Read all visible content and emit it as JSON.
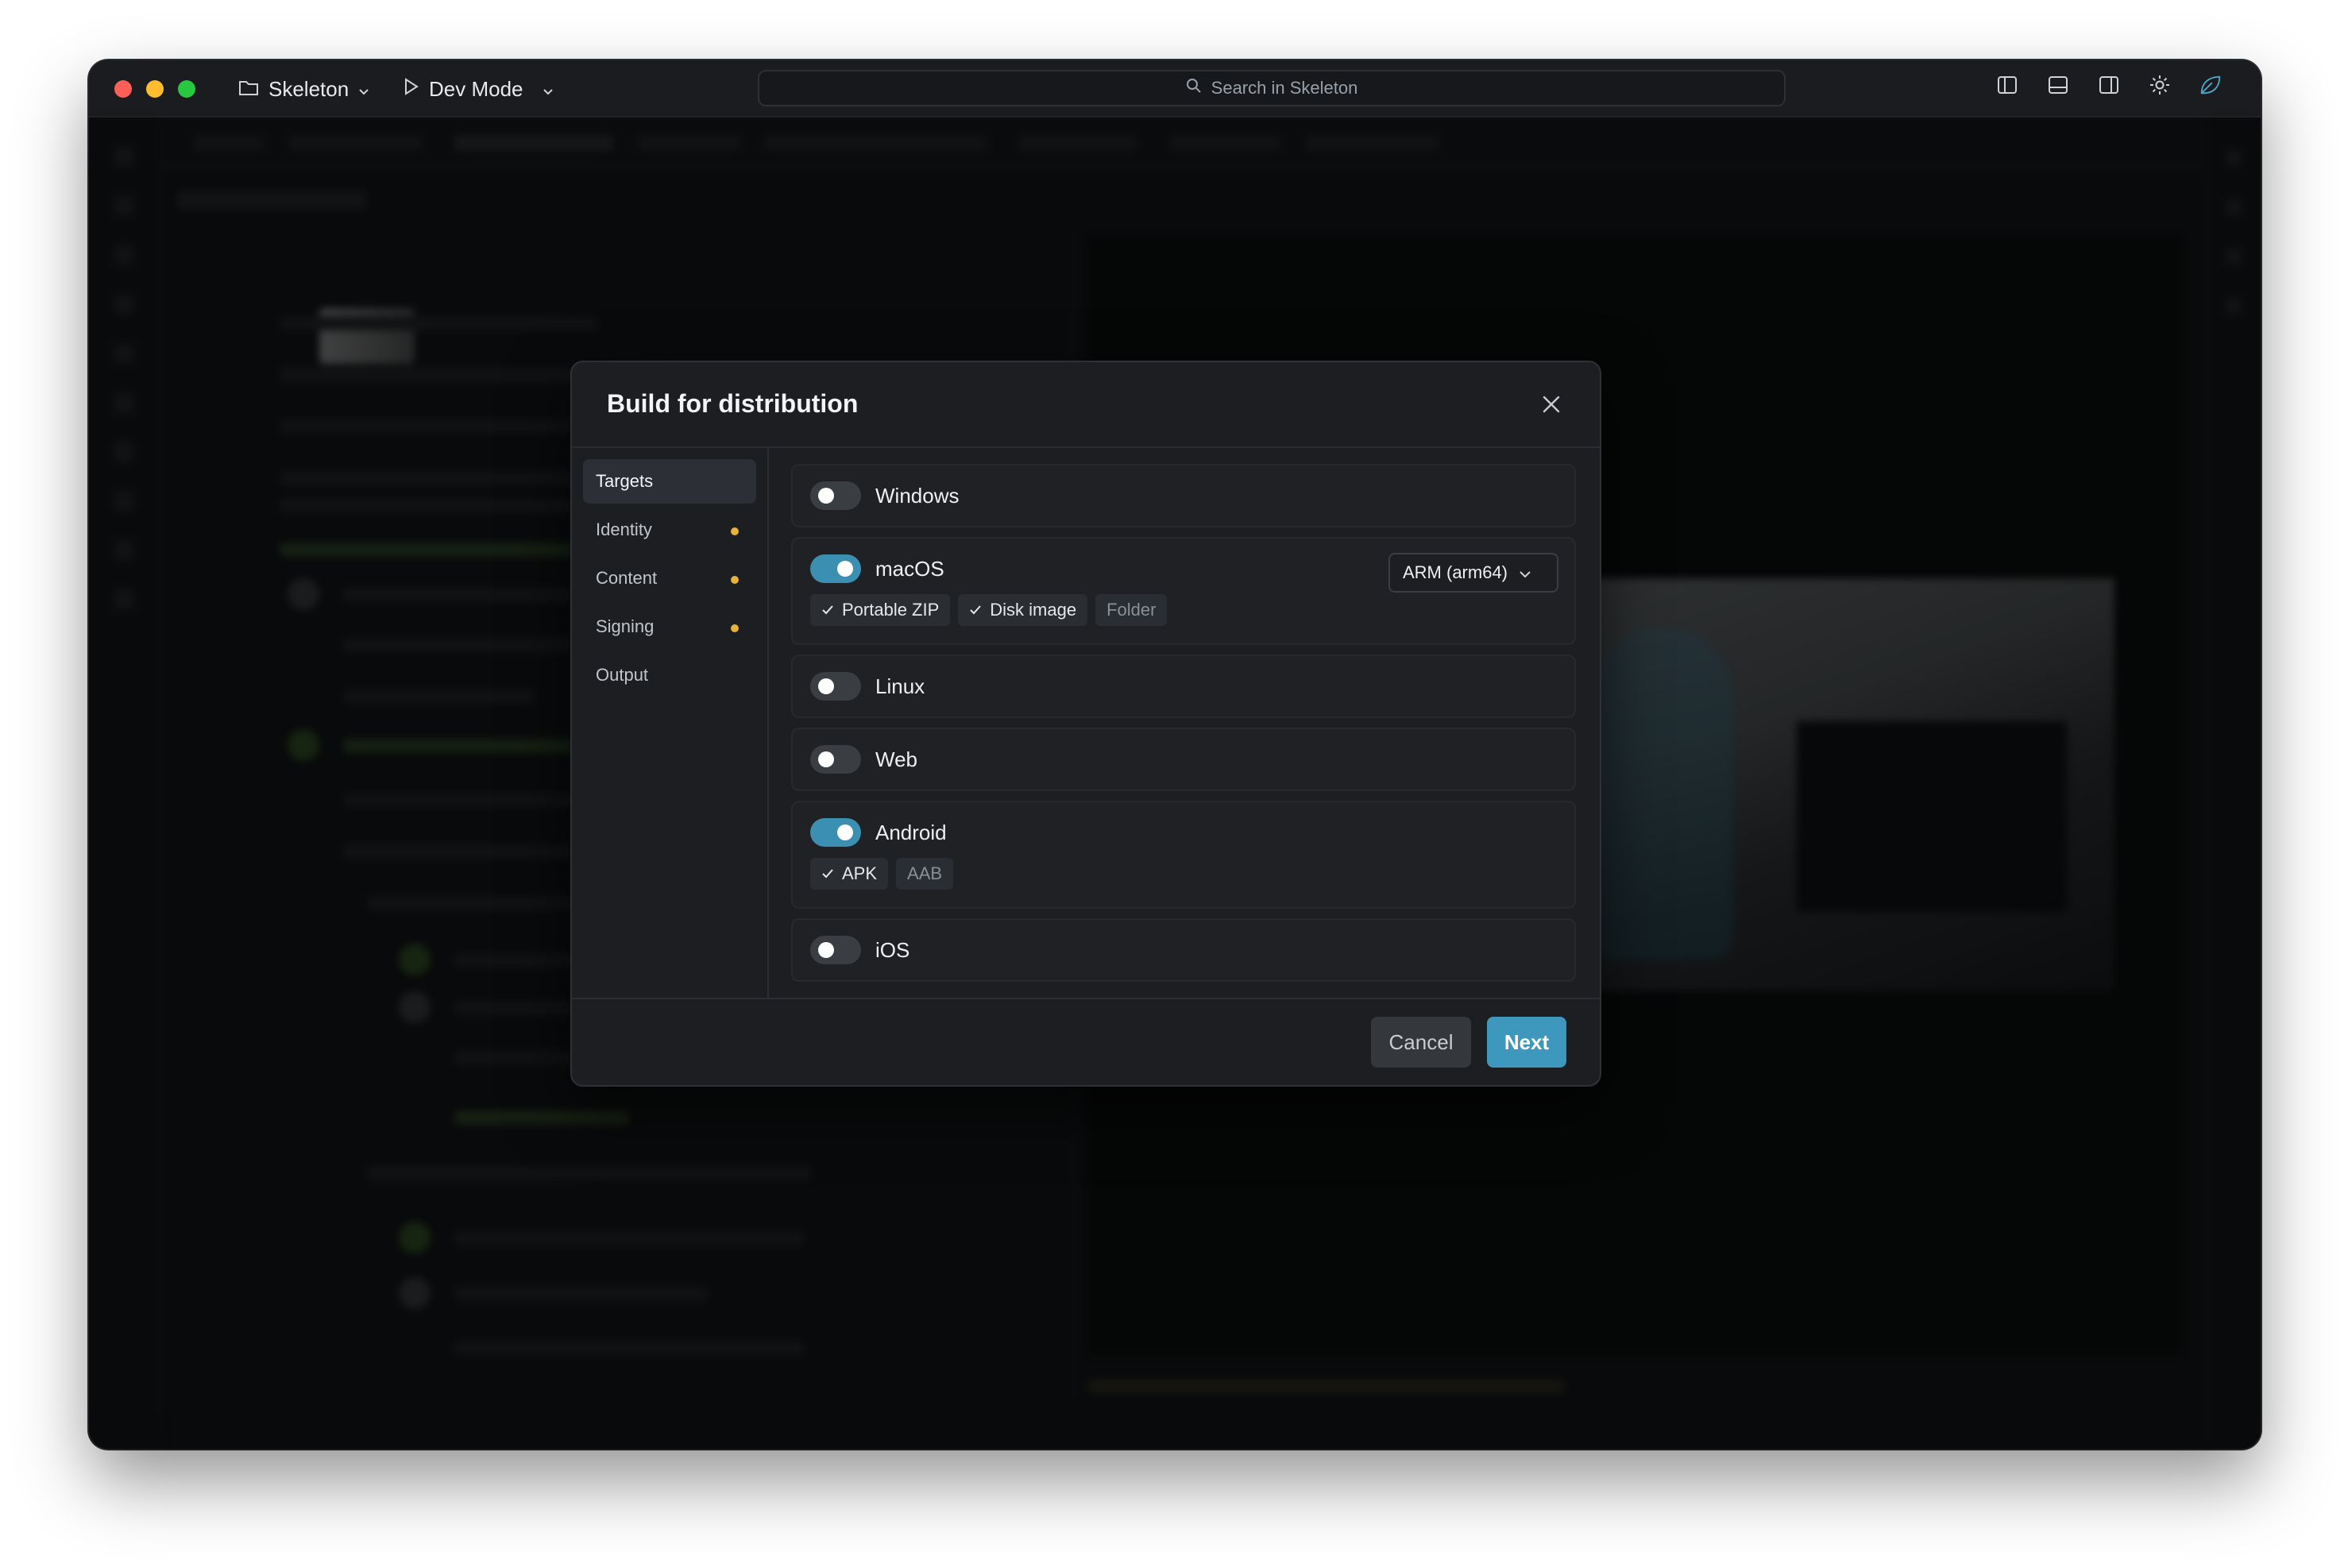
{
  "titlebar": {
    "project_name": "Skeleton",
    "mode_label": "Dev Mode",
    "search_placeholder": "Search in Skeleton"
  },
  "modal": {
    "title": "Build for distribution",
    "nav": [
      {
        "label": "Targets",
        "active": true,
        "pending": false
      },
      {
        "label": "Identity",
        "active": false,
        "pending": true
      },
      {
        "label": "Content",
        "active": false,
        "pending": true
      },
      {
        "label": "Signing",
        "active": false,
        "pending": true
      },
      {
        "label": "Output",
        "active": false,
        "pending": false
      }
    ],
    "targets": {
      "windows": {
        "label": "Windows",
        "enabled": false
      },
      "macos": {
        "label": "macOS",
        "enabled": true,
        "arch": "ARM (arm64)",
        "formats": [
          {
            "label": "Portable ZIP",
            "checked": true
          },
          {
            "label": "Disk image",
            "checked": true
          },
          {
            "label": "Folder",
            "checked": false
          }
        ]
      },
      "linux": {
        "label": "Linux",
        "enabled": false
      },
      "web": {
        "label": "Web",
        "enabled": false
      },
      "android": {
        "label": "Android",
        "enabled": true,
        "formats": [
          {
            "label": "APK",
            "checked": true
          },
          {
            "label": "AAB",
            "checked": false
          }
        ]
      },
      "ios": {
        "label": "iOS",
        "enabled": false
      }
    },
    "cancel_label": "Cancel",
    "next_label": "Next"
  },
  "colors": {
    "accent": "#3e98bd",
    "toggle_on": "#3b8fb0",
    "pending_dot": "#e8b23c",
    "background": "#111315"
  }
}
